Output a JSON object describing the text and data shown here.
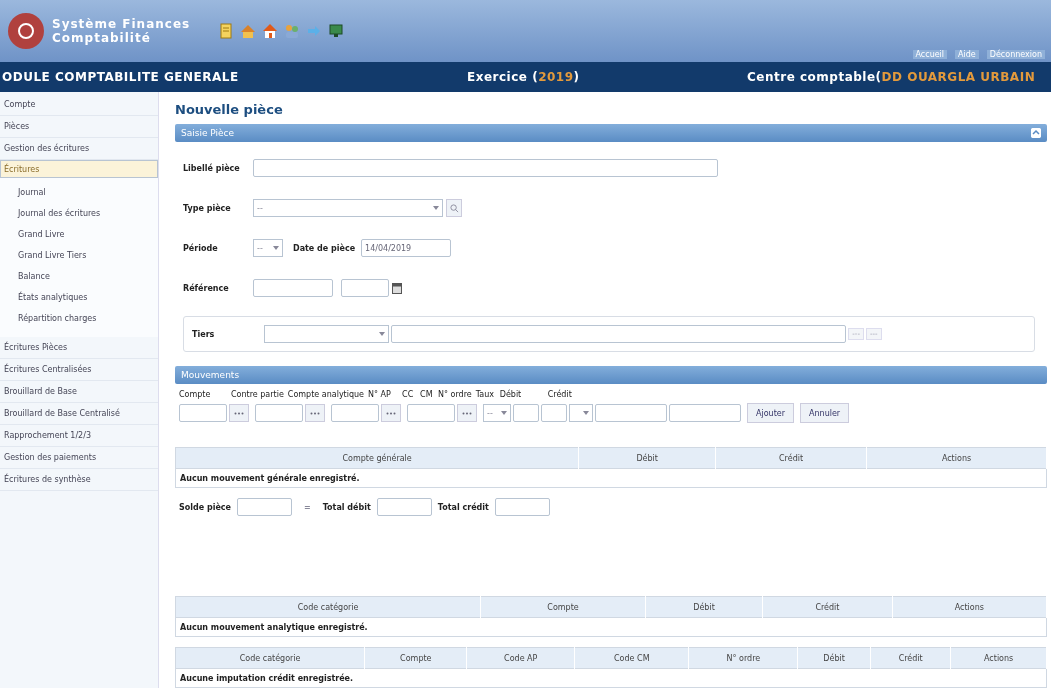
{
  "header": {
    "app_name": "Système Finances",
    "app_subtitle": "Comptabilité",
    "links": [
      "Accueil",
      "Aide",
      "Déconnexion"
    ]
  },
  "module_bar": {
    "module": "ODULE COMPTABILITE GENERALE",
    "exercise_label": "Exercice (",
    "exercise_value": "2019",
    "exercise_end": ")",
    "centre_label": "Centre comptable(",
    "centre_value": "DD OUARGLA URBAIN"
  },
  "sidebar": {
    "items": [
      {
        "label": "Compte",
        "selected": false
      },
      {
        "label": "Pièces",
        "selected": false
      },
      {
        "label": "Gestion des écritures",
        "selected": false
      },
      {
        "label": "Écritures",
        "selected": true,
        "expanded": true,
        "children": [
          {
            "label": "Journal"
          },
          {
            "label": "Journal des écritures"
          },
          {
            "label": "Grand Livre"
          },
          {
            "label": "Grand Livre Tiers"
          },
          {
            "label": "Balance"
          },
          {
            "label": "États analytiques"
          },
          {
            "label": "Répartition charges"
          }
        ]
      },
      {
        "label": "Écritures Pièces",
        "selected": false
      },
      {
        "label": "Écritures Centralisées",
        "selected": false
      },
      {
        "label": "Brouillard de Base",
        "selected": false
      },
      {
        "label": "Brouillard de Base Centralisé",
        "selected": false
      },
      {
        "label": "Rapprochement 1/2/3",
        "selected": false
      },
      {
        "label": "Gestion des paiements",
        "selected": false
      },
      {
        "label": "Écritures de synthèse",
        "selected": false
      }
    ]
  },
  "page_title": "Nouvelle pièce",
  "piece_panel": {
    "title": "Saisie Pièce",
    "fields": [
      {
        "kind": "text",
        "label": "Libellé pièce"
      },
      {
        "kind": "select",
        "label": "Type pièce",
        "value": "--"
      },
      {
        "kind": "period",
        "label": "Période",
        "value": "--",
        "date_label": "Date de pièce",
        "date_value": "14/04/2019"
      },
      {
        "kind": "reference",
        "label": "Référence"
      }
    ],
    "tiers": {
      "label": "Tiers",
      "buttons": [
        "---",
        "---"
      ]
    }
  },
  "movements_panel": {
    "title": "Mouvements",
    "labels": [
      "Compte",
      "Contre partie",
      "Compte analytique",
      "N° AP",
      "CC",
      "CM",
      "N° ordre",
      "Taux",
      "Débit",
      "Crédit"
    ],
    "cc_value": "--",
    "buttons": [
      "Ajouter",
      "Annuler"
    ]
  },
  "general_table": {
    "columns": [
      "Compte générale",
      "Débit",
      "Crédit",
      "Actions"
    ],
    "empty": "Aucun mouvement générale enregistré."
  },
  "totals": {
    "solde_label": "Solde pièce",
    "equals": "=",
    "debit_label": "Total débit",
    "credit_label": "Total crédit"
  },
  "analytic_table": {
    "columns": [
      "Code catégorie",
      "Compte",
      "Débit",
      "Crédit",
      "Actions"
    ],
    "empty": "Aucun mouvement analytique enregistré."
  },
  "credit_table": {
    "columns": [
      "Code catégorie",
      "Compte",
      "Code AP",
      "Code CM",
      "N° ordre",
      "Débit",
      "Crédit",
      "Actions"
    ],
    "empty": "Aucune imputation crédit enregistrée."
  }
}
